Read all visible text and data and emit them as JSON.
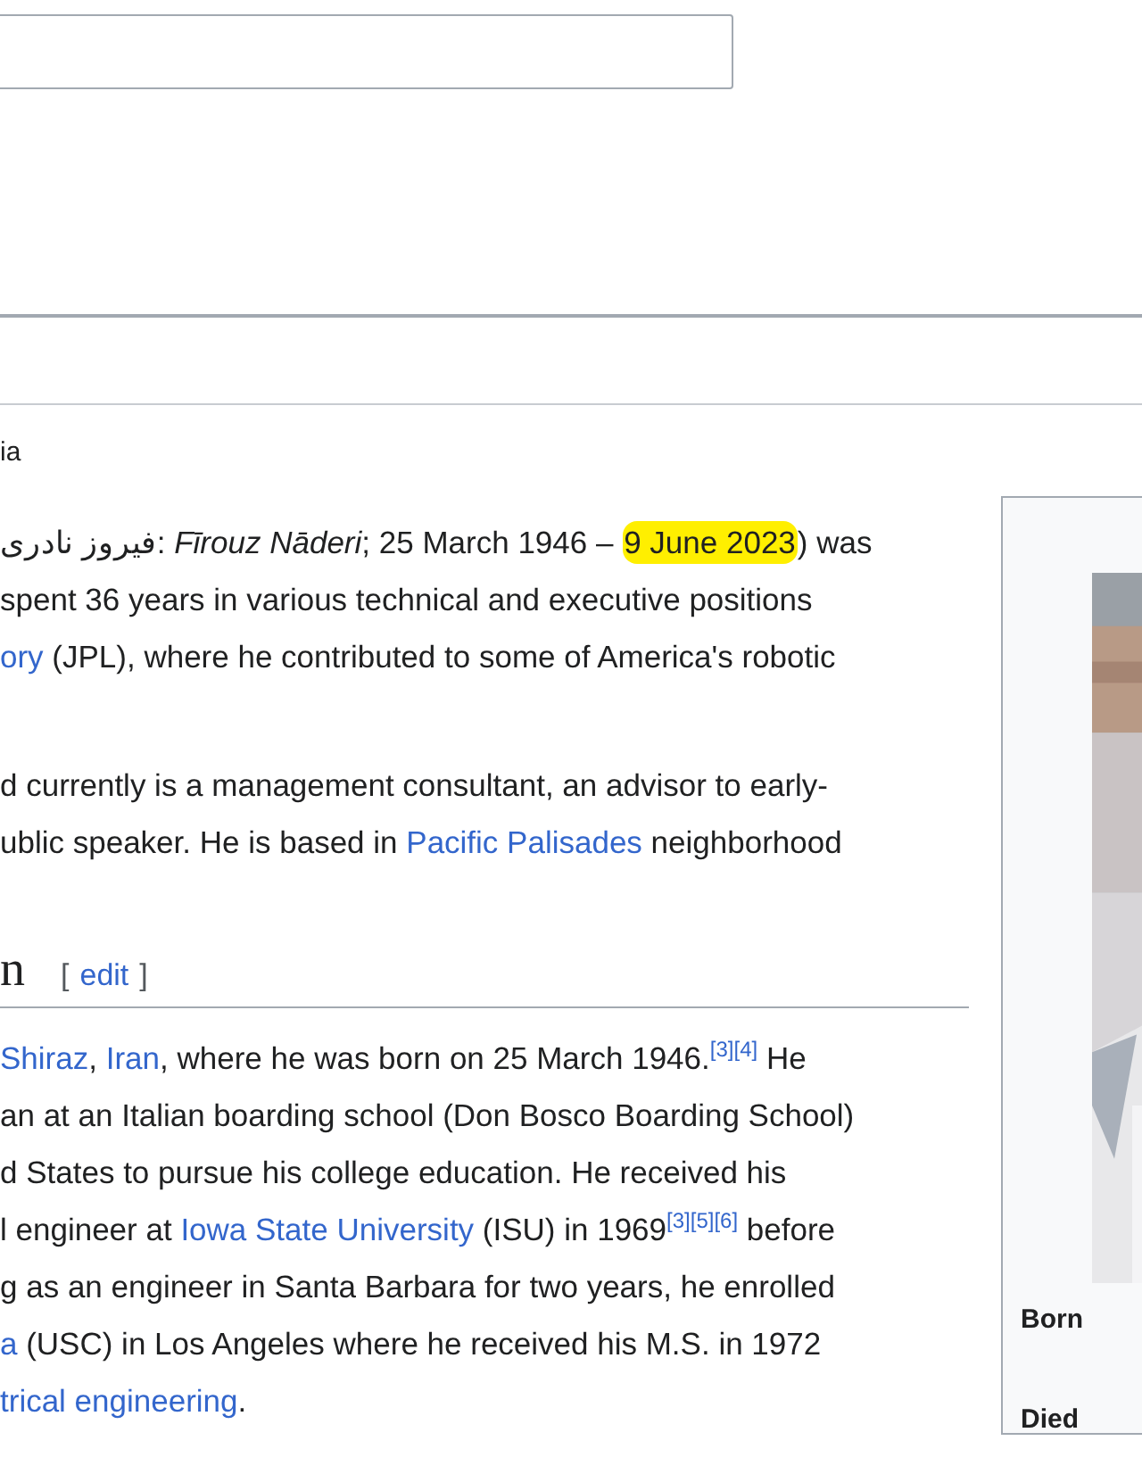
{
  "tagline": "ia",
  "blocks": [
    {
      "kind": "paragraph",
      "lines": [
        [
          {
            "kind": "rtl",
            "text": "فیروز نادری"
          },
          {
            "kind": "text",
            "text": ": "
          },
          {
            "kind": "italic",
            "text": "Fīrouz Nāderi"
          },
          {
            "kind": "text",
            "text": "; 25 March 1946 – "
          },
          {
            "kind": "highlight",
            "text": "9 June 2023"
          },
          {
            "kind": "text",
            "text": ") was"
          }
        ],
        [
          {
            "kind": "text",
            "text": "spent 36 years in various technical and executive positions"
          }
        ],
        [
          {
            "kind": "link",
            "text": "ory"
          },
          {
            "kind": "text",
            "text": " (JPL), where he contributed to some of America's robotic"
          }
        ]
      ]
    },
    {
      "kind": "paragraph",
      "lines": [
        [
          {
            "kind": "text",
            "text": "d currently is a management consultant, an advisor to early-"
          }
        ],
        [
          {
            "kind": "text",
            "text": "ublic speaker. He is based in "
          },
          {
            "kind": "link",
            "text": "Pacific Palisades"
          },
          {
            "kind": "text",
            "text": " neighborhood"
          }
        ]
      ]
    },
    {
      "kind": "heading",
      "title": "n",
      "bracket_open": "[",
      "edit": "edit",
      "bracket_close": "]"
    },
    {
      "kind": "paragraph",
      "lines": [
        [
          {
            "kind": "link",
            "text": "Shiraz"
          },
          {
            "kind": "text",
            "text": ", "
          },
          {
            "kind": "link",
            "text": "Iran"
          },
          {
            "kind": "text",
            "text": ", where he was born on 25 March 1946."
          },
          {
            "kind": "cite",
            "text": "[3]"
          },
          {
            "kind": "cite",
            "text": "[4]"
          },
          {
            "kind": "text",
            "text": " He"
          }
        ],
        [
          {
            "kind": "text",
            "text": "an at an Italian boarding school (Don Bosco Boarding School)"
          }
        ],
        [
          {
            "kind": "text",
            "text": "d States to pursue his college education. He received his"
          }
        ],
        [
          {
            "kind": "text",
            "text": "l engineer at "
          },
          {
            "kind": "link",
            "text": "Iowa State University"
          },
          {
            "kind": "text",
            "text": " (ISU) in 1969"
          },
          {
            "kind": "cite",
            "text": "[3]"
          },
          {
            "kind": "cite",
            "text": "[5]"
          },
          {
            "kind": "cite",
            "text": "[6]"
          },
          {
            "kind": "text",
            "text": " before"
          }
        ],
        [
          {
            "kind": "text",
            "text": "g as an engineer in Santa Barbara for two years, he enrolled"
          }
        ],
        [
          {
            "kind": "link",
            "text": "a"
          },
          {
            "kind": "text",
            "text": " (USC) in Los Angeles where he received his M.S. in 1972"
          }
        ],
        [
          {
            "kind": "link",
            "text": "trical engineering"
          },
          {
            "kind": "text",
            "text": "."
          }
        ]
      ]
    }
  ],
  "infobox": {
    "picture": {
      "kind": "picture"
    },
    "labels": [
      "Born",
      "Died"
    ]
  }
}
